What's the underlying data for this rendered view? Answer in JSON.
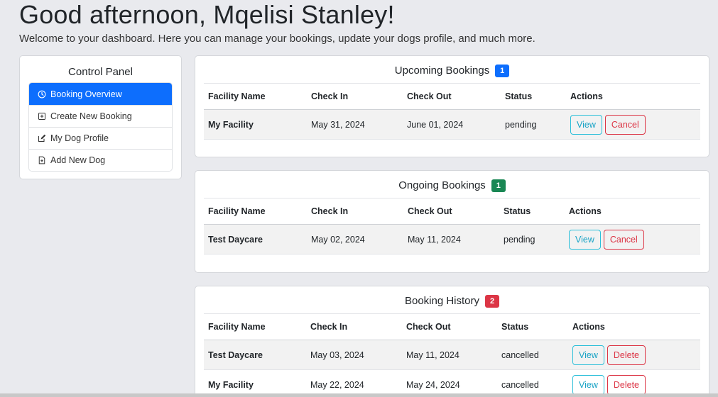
{
  "header": {
    "greeting": "Good afternoon, Mqelisi Stanley!",
    "welcome": "Welcome to your dashboard. Here you can manage your bookings, update your dogs profile, and much more."
  },
  "control_panel": {
    "title": "Control Panel",
    "items": [
      {
        "label": "Booking Overview",
        "icon": "clock-icon"
      },
      {
        "label": "Create New Booking",
        "icon": "plus-square-icon"
      },
      {
        "label": "My Dog Profile",
        "icon": "pencil-square-icon"
      },
      {
        "label": "Add New Dog",
        "icon": "file-plus-icon"
      }
    ]
  },
  "columns": [
    "Facility Name",
    "Check In",
    "Check Out",
    "Status",
    "Actions"
  ],
  "upcoming": {
    "title": "Upcoming Bookings",
    "count": "1",
    "badge_color": "#0d6efd",
    "rows": [
      {
        "facility": "My Facility",
        "check_in": "May 31, 2024",
        "check_out": "June 01, 2024",
        "status": "pending",
        "action1": "View",
        "action2": "Cancel"
      }
    ]
  },
  "ongoing": {
    "title": "Ongoing Bookings",
    "count": "1",
    "badge_color": "#198754",
    "rows": [
      {
        "facility": "Test Daycare",
        "check_in": "May 02, 2024",
        "check_out": "May 11, 2024",
        "status": "pending",
        "action1": "View",
        "action2": "Cancel"
      }
    ]
  },
  "history": {
    "title": "Booking History",
    "count": "2",
    "badge_color": "#dc3545",
    "rows": [
      {
        "facility": "Test Daycare",
        "check_in": "May 03, 2024",
        "check_out": "May 11, 2024",
        "status": "cancelled",
        "action1": "View",
        "action2": "Delete"
      },
      {
        "facility": "My Facility",
        "check_in": "May 22, 2024",
        "check_out": "May 24, 2024",
        "status": "cancelled",
        "action1": "View",
        "action2": "Delete"
      }
    ]
  }
}
